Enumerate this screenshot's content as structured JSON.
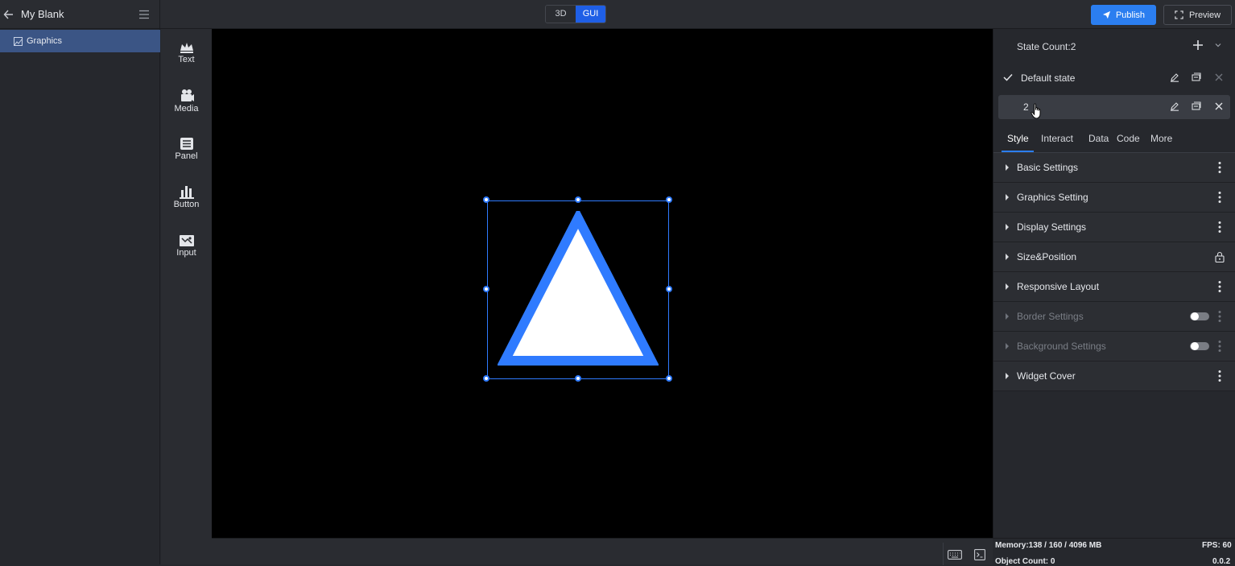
{
  "header": {
    "app_title": "My Blank",
    "mode_3d": "3D",
    "mode_gui": "GUI",
    "publish_label": "Publish",
    "preview_label": "Preview"
  },
  "tree": {
    "items": [
      {
        "label": "Graphics"
      }
    ]
  },
  "palette": {
    "items": [
      {
        "label": "Text"
      },
      {
        "label": "Media"
      },
      {
        "label": "Panel"
      },
      {
        "label": "Button"
      },
      {
        "label": "Input"
      }
    ]
  },
  "states": {
    "count_label": "State Count:2",
    "rows": [
      {
        "name": "Default state"
      },
      {
        "name": "2"
      }
    ]
  },
  "tabs": [
    "Style",
    "Interact",
    "Data",
    "Code",
    "More"
  ],
  "sections": [
    {
      "label": "Basic Settings"
    },
    {
      "label": "Graphics Setting"
    },
    {
      "label": "Display Settings"
    },
    {
      "label": "Size&Position"
    },
    {
      "label": "Responsive Layout"
    },
    {
      "label": "Border Settings"
    },
    {
      "label": "Background Settings"
    },
    {
      "label": "Widget Cover"
    }
  ],
  "stats": {
    "memory": "Memory:138 / 160 / 4096 MB",
    "fps": "FPS: 60",
    "object_count": "Object Count: 0",
    "version": "0.0.2"
  },
  "colors": {
    "accent": "#2b7ef0",
    "selection": "#2f7bff",
    "triangle_stroke": "#2f7bff",
    "triangle_fill": "#ffffff",
    "canvas_bg": "#000000"
  }
}
